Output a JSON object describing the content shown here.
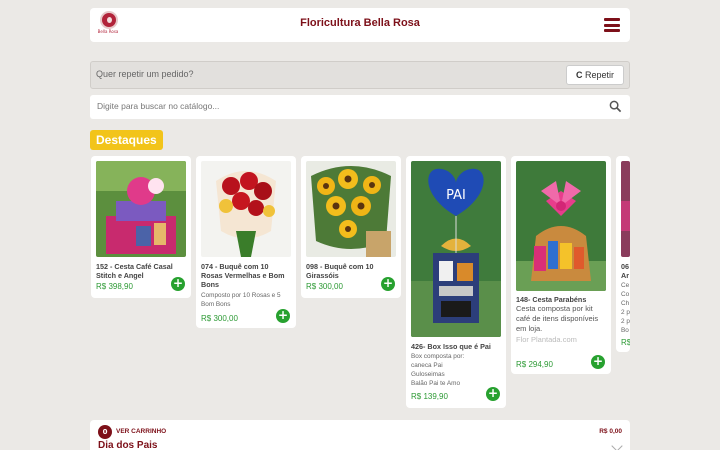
{
  "header": {
    "logo_text": "Bella Rosa",
    "title": "Floricultura Bella Rosa"
  },
  "repeat": {
    "placeholder": "Quer repetir um pedido?",
    "button_label": "Repetir",
    "button_icon": "refresh-icon"
  },
  "search": {
    "placeholder": "Digite para buscar no catálogo..."
  },
  "featured_label": "Destaques",
  "products": [
    {
      "name": "152 - Cesta Café Casal Stitch e Angel",
      "desc": "",
      "price": "R$ 398,90"
    },
    {
      "name": "074 - Buquê com 10 Rosas Vermelhas e Bom Bons",
      "desc": "Composto por 10 Rosas e 5 Bom Bons",
      "price": "R$ 300,00"
    },
    {
      "name": "098 - Buquê com 10 Girassóis",
      "desc": "",
      "price": "R$ 300,00"
    },
    {
      "name": "426- Box Isso que é Pai",
      "desc_lines": [
        "Box composta por:",
        "caneca Pai",
        "Guloseimas",
        "Balão Pai te Amo"
      ],
      "price": "R$ 139,90"
    },
    {
      "name": "148- Cesta Parabéns",
      "desc": "Cesta composta por kit café de itens disponíveis em loja.",
      "store": "Flor Plantada.com",
      "price": "R$ 294,90"
    },
    {
      "name_lines": [
        "06",
        "Ar"
      ],
      "desc_lines": [
        "Ce",
        "Co",
        "Ch",
        "2 p",
        "2 p",
        "Bo"
      ],
      "price": "R$"
    }
  ],
  "cart": {
    "count": "0",
    "label": "VER CARRINHO",
    "total": "R$ 0,00"
  },
  "section_title": "Dia dos Pais",
  "colors": {
    "brand": "#7d1019",
    "accent": "#f2c41a",
    "add": "#27a12f",
    "price": "#2d9a35"
  }
}
